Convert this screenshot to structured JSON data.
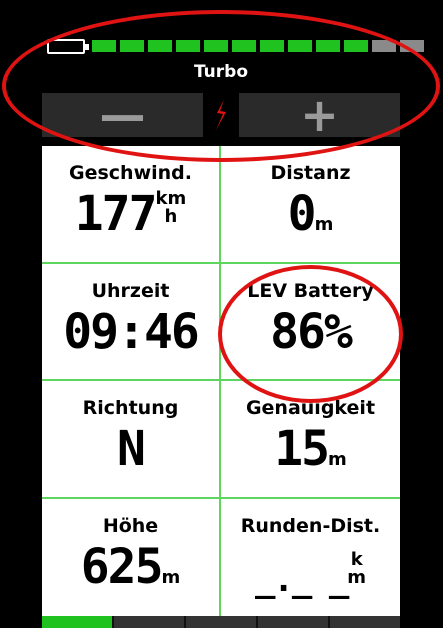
{
  "header": {
    "mode_label": "Turbo",
    "level_segments": {
      "filled": 10,
      "total": 12
    },
    "minus_label": "—",
    "plus_label": "+",
    "logo_icon": "specialized-s-icon"
  },
  "fields": [
    {
      "label": "Geschwind.",
      "value": "177",
      "unit_top": "km",
      "unit_bottom": "h"
    },
    {
      "label": "Distanz",
      "value": "0",
      "unit": "m"
    },
    {
      "label": "Uhrzeit",
      "value": "09:46"
    },
    {
      "label": "LEV Battery",
      "value": "86%"
    },
    {
      "label": "Richtung",
      "value": "N"
    },
    {
      "label": "Genauigkeit",
      "value": "15",
      "unit": "m"
    },
    {
      "label": "Höhe",
      "value": "625",
      "unit": "m"
    },
    {
      "label": "Runden-Dist.",
      "value": "_._ _",
      "unit_top": "k",
      "unit_bottom": "m"
    }
  ],
  "colors": {
    "accent": "#1fc21f",
    "highlight_ring": "#e01313"
  }
}
